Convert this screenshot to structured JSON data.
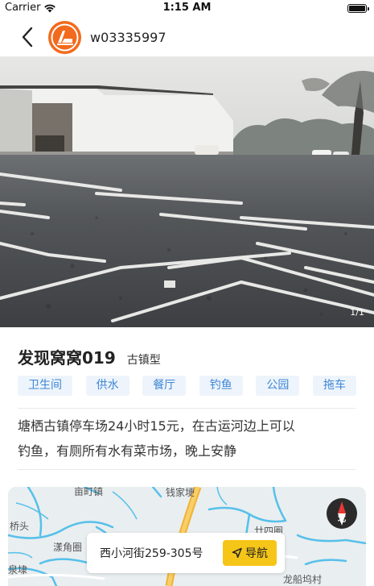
{
  "status_bar": {
    "carrier": "Carrier",
    "time": "1:15 AM"
  },
  "header": {
    "username": "w03335997"
  },
  "photo": {
    "counter": "1/1"
  },
  "spot": {
    "title": "发现窝窝019",
    "type": "古镇型",
    "tags": [
      "卫生间",
      "供水",
      "餐厅",
      "钓鱼",
      "公园",
      "拖车"
    ],
    "description_lines": [
      "塘栖古镇停车场24小时15元，在古运河边上可以",
      "钓鱼，有厕所有水有菜市场，晚上安静"
    ]
  },
  "map": {
    "labels": [
      "亩町镇",
      "钱家埂",
      "桥头",
      "漾角圈",
      "廿四圈",
      "泉埭",
      "龙船坞村"
    ],
    "compass_label": "北",
    "address": "西小河街259-305号",
    "navigate_label": "导航",
    "colors": {
      "water": "#56c0ea",
      "road": "#f2b233"
    }
  },
  "colors": {
    "accent_yellow": "#f5c518",
    "tag_text": "#3d86d6",
    "tag_bg": "#eef4fb",
    "avatar": "#f26a1b"
  }
}
